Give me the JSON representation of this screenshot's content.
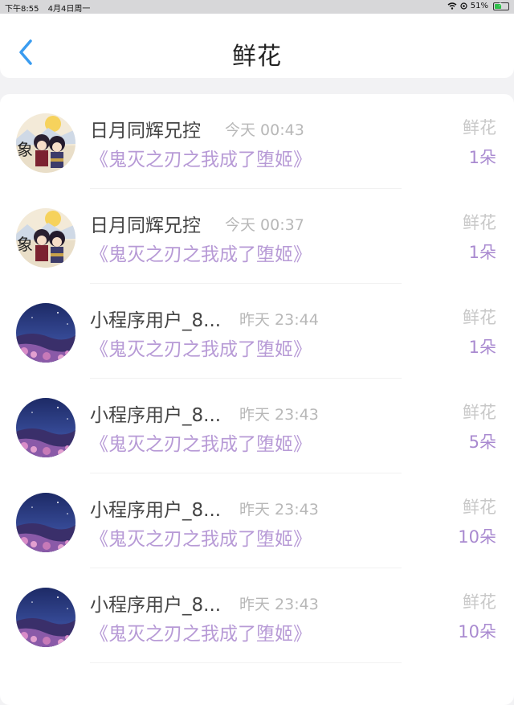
{
  "status_bar": {
    "time": "下午8:55",
    "date": "4月4日周一",
    "battery": "51%",
    "battery_level": 0.51
  },
  "header": {
    "title": "鲜花"
  },
  "records": [
    {
      "user": "日月同辉兄控",
      "time": "今天 00:43",
      "book": "《鬼灭之刃之我成了堕姬》",
      "gift": "鲜花",
      "qty": "1朵",
      "avatar": "anime-avatar"
    },
    {
      "user": "日月同辉兄控",
      "time": "今天 00:37",
      "book": "《鬼灭之刃之我成了堕姬》",
      "gift": "鲜花",
      "qty": "1朵",
      "avatar": "anime-avatar"
    },
    {
      "user": "小程序用户_8...",
      "time": "昨天 23:44",
      "book": "《鬼灭之刃之我成了堕姬》",
      "gift": "鲜花",
      "qty": "1朵",
      "avatar": "night-sky-avatar"
    },
    {
      "user": "小程序用户_8...",
      "time": "昨天 23:43",
      "book": "《鬼灭之刃之我成了堕姬》",
      "gift": "鲜花",
      "qty": "5朵",
      "avatar": "night-sky-avatar"
    },
    {
      "user": "小程序用户_8...",
      "time": "昨天 23:43",
      "book": "《鬼灭之刃之我成了堕姬》",
      "gift": "鲜花",
      "qty": "10朵",
      "avatar": "night-sky-avatar"
    },
    {
      "user": "小程序用户_8...",
      "time": "昨天 23:43",
      "book": "《鬼灭之刃之我成了堕姬》",
      "gift": "鲜花",
      "qty": "10朵",
      "avatar": "night-sky-avatar"
    }
  ],
  "colors": {
    "accent": "#3a9cf0",
    "book_title": "#b79ad6",
    "quantity": "#a98ad0",
    "muted": "#b8b8b8"
  }
}
